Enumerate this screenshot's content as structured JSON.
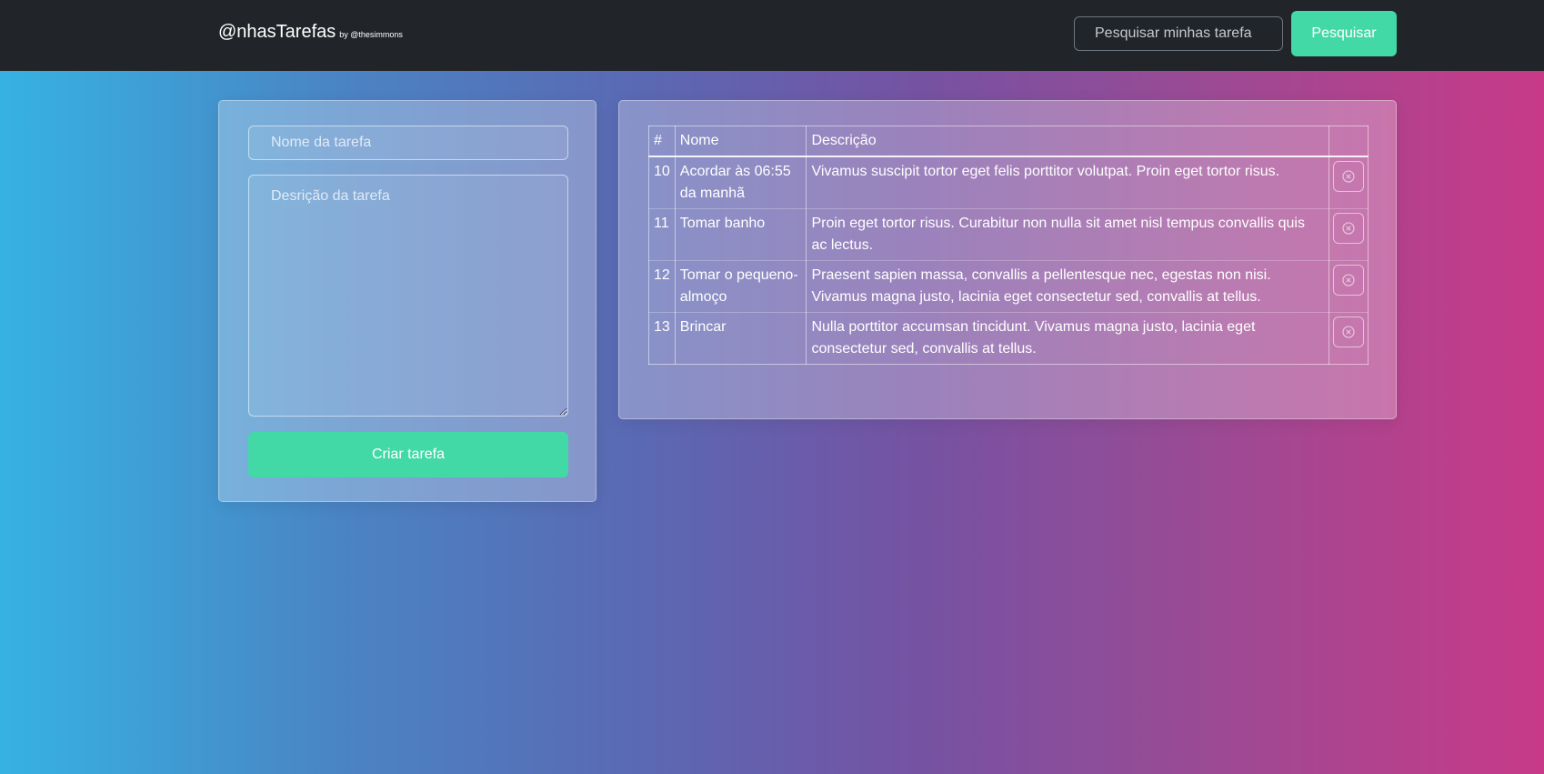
{
  "header": {
    "brand": "@nhasTarefas",
    "brand_by": "by @thesimmons",
    "search_placeholder": "Pesquisar minhas tarefa",
    "search_button": "Pesquisar"
  },
  "form": {
    "name_placeholder": "Nome da tarefa",
    "description_placeholder": "Desrição da tarefa",
    "submit_label": "Criar tarefa"
  },
  "table": {
    "headers": {
      "id": "#",
      "name": "Nome",
      "description": "Descrição",
      "actions": ""
    },
    "rows": [
      {
        "id": "10",
        "name": "Acordar às 06:55 da manhã",
        "description": "Vivamus suscipit tortor eget felis porttitor volutpat. Proin eget tortor risus.",
        "delete_icon": "circle-x-icon"
      },
      {
        "id": "11",
        "name": "Tomar banho",
        "description": "Proin eget tortor risus. Curabitur non nulla sit amet nisl tempus convallis quis ac lectus.",
        "delete_icon": "circle-x-icon"
      },
      {
        "id": "12",
        "name": "Tomar o pequeno-almoço",
        "description": "Praesent sapien massa, convallis a pellentesque nec, egestas non nisi. Vivamus magna justo, lacinia eget consectetur sed, convallis at tellus.",
        "delete_icon": "circle-x-icon"
      },
      {
        "id": "13",
        "name": "Brincar",
        "description": "Nulla porttitor accumsan tincidunt. Vivamus magna justo, lacinia eget consectetur sed, convallis at tellus.",
        "delete_icon": "circle-x-icon"
      }
    ]
  },
  "colors": {
    "navbar": "#212529",
    "accent": "#42d9a7",
    "gradient_start": "#36b2e2",
    "gradient_end": "#c83a88"
  }
}
